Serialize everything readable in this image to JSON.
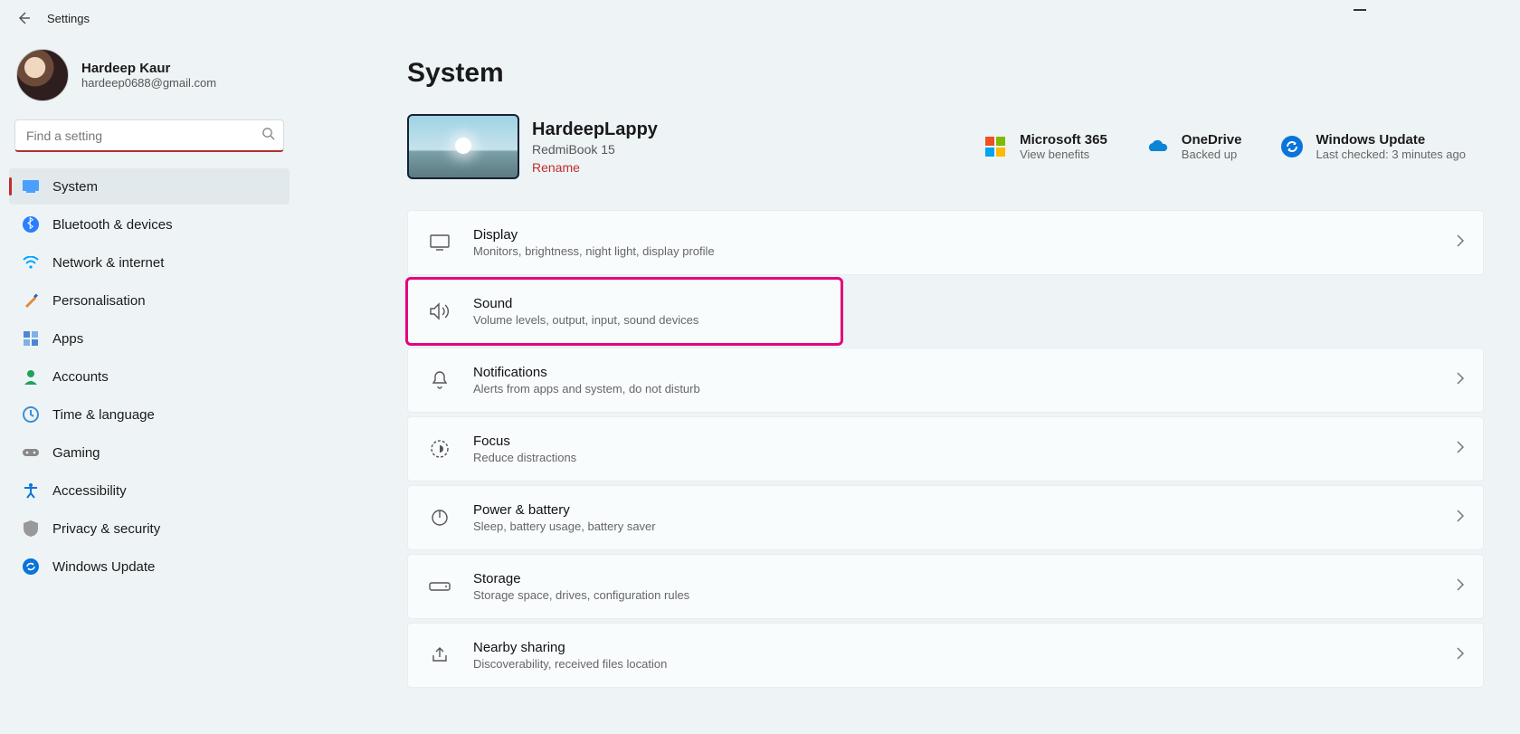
{
  "titlebar": {
    "title": "Settings"
  },
  "profile": {
    "name": "Hardeep Kaur",
    "email": "hardeep0688@gmail.com"
  },
  "search": {
    "placeholder": "Find a setting"
  },
  "nav": {
    "items": [
      {
        "label": "System"
      },
      {
        "label": "Bluetooth & devices"
      },
      {
        "label": "Network & internet"
      },
      {
        "label": "Personalisation"
      },
      {
        "label": "Apps"
      },
      {
        "label": "Accounts"
      },
      {
        "label": "Time & language"
      },
      {
        "label": "Gaming"
      },
      {
        "label": "Accessibility"
      },
      {
        "label": "Privacy & security"
      },
      {
        "label": "Windows Update"
      }
    ]
  },
  "page": {
    "title": "System"
  },
  "device": {
    "name": "HardeepLappy",
    "model": "RedmiBook 15",
    "rename": "Rename"
  },
  "quicklinks": {
    "m365": {
      "title": "Microsoft 365",
      "sub": "View benefits"
    },
    "onedrive": {
      "title": "OneDrive",
      "sub": "Backed up"
    },
    "wu": {
      "title": "Windows Update",
      "sub": "Last checked: 3 minutes ago"
    }
  },
  "items": [
    {
      "title": "Display",
      "sub": "Monitors, brightness, night light, display profile"
    },
    {
      "title": "Sound",
      "sub": "Volume levels, output, input, sound devices"
    },
    {
      "title": "Notifications",
      "sub": "Alerts from apps and system, do not disturb"
    },
    {
      "title": "Focus",
      "sub": "Reduce distractions"
    },
    {
      "title": "Power & battery",
      "sub": "Sleep, battery usage, battery saver"
    },
    {
      "title": "Storage",
      "sub": "Storage space, drives, configuration rules"
    },
    {
      "title": "Nearby sharing",
      "sub": "Discoverability, received files location"
    }
  ]
}
